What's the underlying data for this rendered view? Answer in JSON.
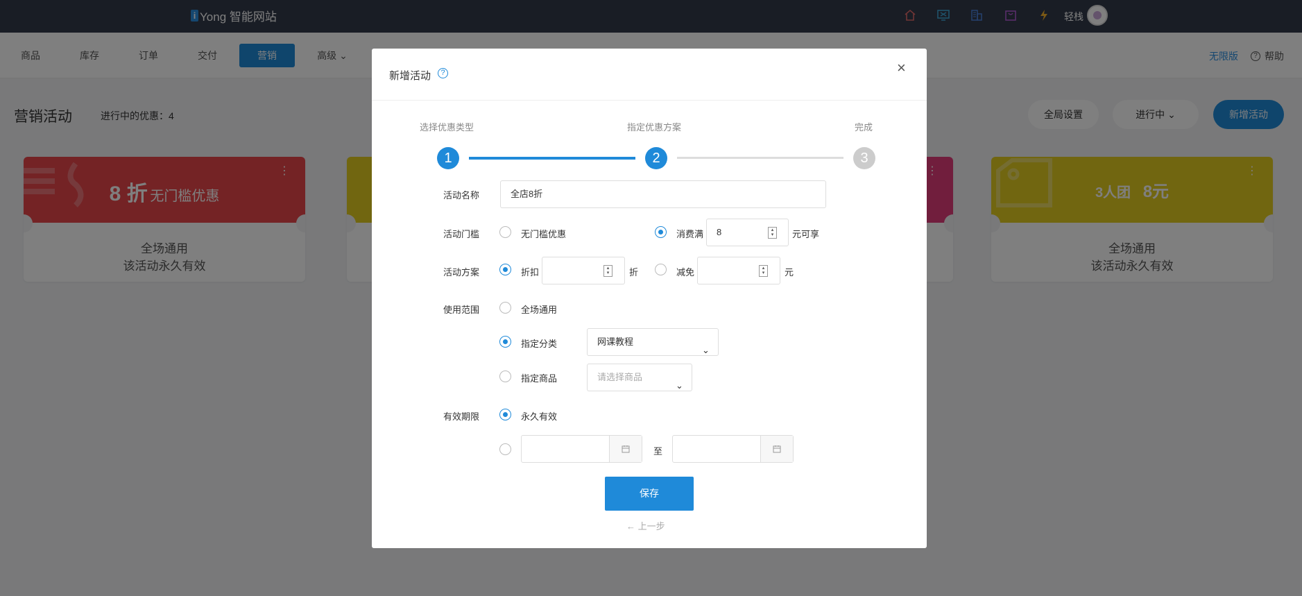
{
  "topbar": {
    "logo_mark": "i",
    "logo_text": "Yong 智能网站",
    "icons": [
      "home-icon",
      "monitor-icon",
      "building-icon",
      "bag-icon",
      "lightning-icon"
    ],
    "user_name": "轻栈"
  },
  "nav": {
    "items": [
      {
        "label": "商品"
      },
      {
        "label": "库存"
      },
      {
        "label": "订单"
      },
      {
        "label": "交付"
      },
      {
        "label": "营销"
      },
      {
        "label": "高级 ⌄"
      }
    ],
    "active": "营销",
    "edition": "无限版",
    "help": "帮助"
  },
  "page": {
    "title": "营销活动",
    "active_count": "进行中的优惠：4",
    "global_settings": "全局设置",
    "status_filter": "进行中 ⌄",
    "new_activity": "新增活动"
  },
  "cards": [
    {
      "head_big": "8 折",
      "head_small": "无门槛优惠",
      "line1": "全场通用",
      "line2": "该活动永久有效",
      "color": "#e8474b"
    },
    {
      "head_big": "3人团",
      "head_small": "8元",
      "line1": "全场通用",
      "line2": "该活动永久有效",
      "color": "#e3cc21"
    }
  ],
  "modal": {
    "title": "新增活动",
    "help_icon": "?",
    "close": "×",
    "steps": [
      {
        "label": "选择优惠类型",
        "num": "1"
      },
      {
        "label": "指定优惠方案",
        "num": "2"
      },
      {
        "label": "完成",
        "num": "3"
      }
    ],
    "form": {
      "name_label": "活动名称",
      "name_value": "全店8折",
      "threshold_label": "活动门槛",
      "threshold_opt1": "无门槛优惠",
      "threshold_opt2": "消费满",
      "threshold_value": "8",
      "threshold_suffix": "元可享",
      "plan_label": "活动方案",
      "plan_opt1": "折扣",
      "plan_suffix1": "折",
      "plan_opt2": "减免",
      "plan_suffix2": "元",
      "scope_label": "使用范围",
      "scope_opt1": "全场通用",
      "scope_opt2": "指定分类",
      "scope_category_value": "网课教程",
      "scope_opt3": "指定商品",
      "scope_product_placeholder": "请选择商品",
      "validity_label": "有效期限",
      "validity_opt1": "永久有效",
      "date_separator": "至"
    },
    "save": "保存",
    "prev": "← 上一步"
  }
}
